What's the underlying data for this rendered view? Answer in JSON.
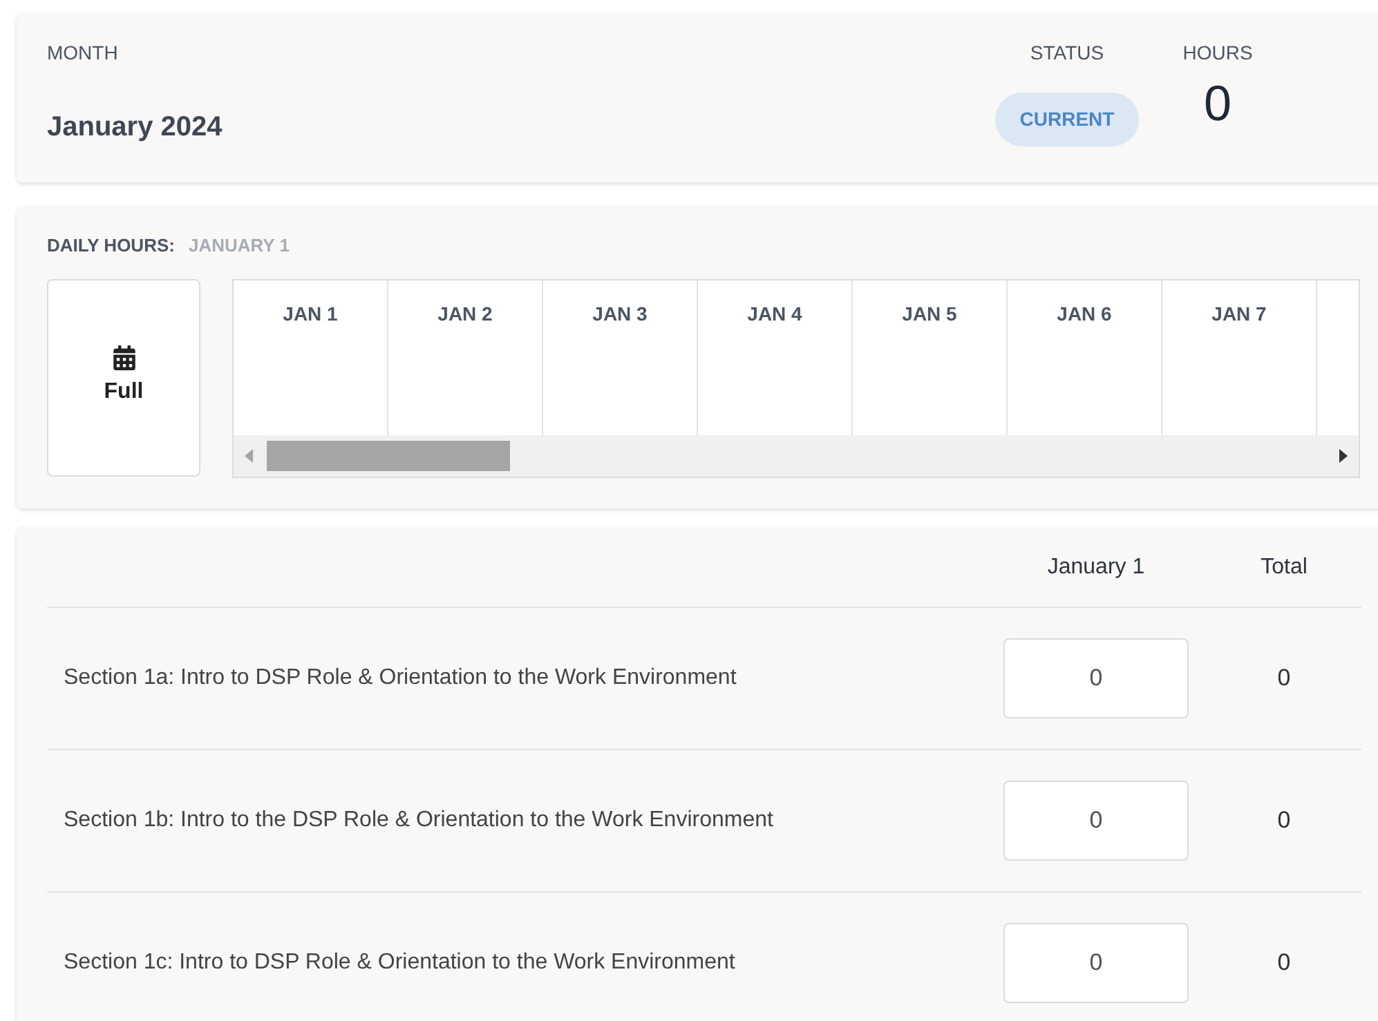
{
  "summary": {
    "month_label": "MONTH",
    "month": "January 2024",
    "status_label": "STATUS",
    "status": "CURRENT",
    "hours_label": "HOURS",
    "hours": "0"
  },
  "daily": {
    "label": "DAILY HOURS:",
    "selected_date": "JANUARY 1",
    "full_button": "Full",
    "days": [
      "JAN 1",
      "JAN 2",
      "JAN 3",
      "JAN 4",
      "JAN 5",
      "JAN 6",
      "JAN 7"
    ]
  },
  "table": {
    "columns": [
      "January 1",
      "Total"
    ],
    "rows": [
      {
        "section": "Section 1a: Intro to DSP Role & Orientation to the Work Environment",
        "value": "0",
        "total": "0"
      },
      {
        "section": "Section 1b: Intro to the DSP Role & Orientation to the Work Environment",
        "value": "0",
        "total": "0"
      },
      {
        "section": "Section 1c: Intro to DSP Role & Orientation to the Work Environment",
        "value": "0",
        "total": "0"
      }
    ]
  }
}
